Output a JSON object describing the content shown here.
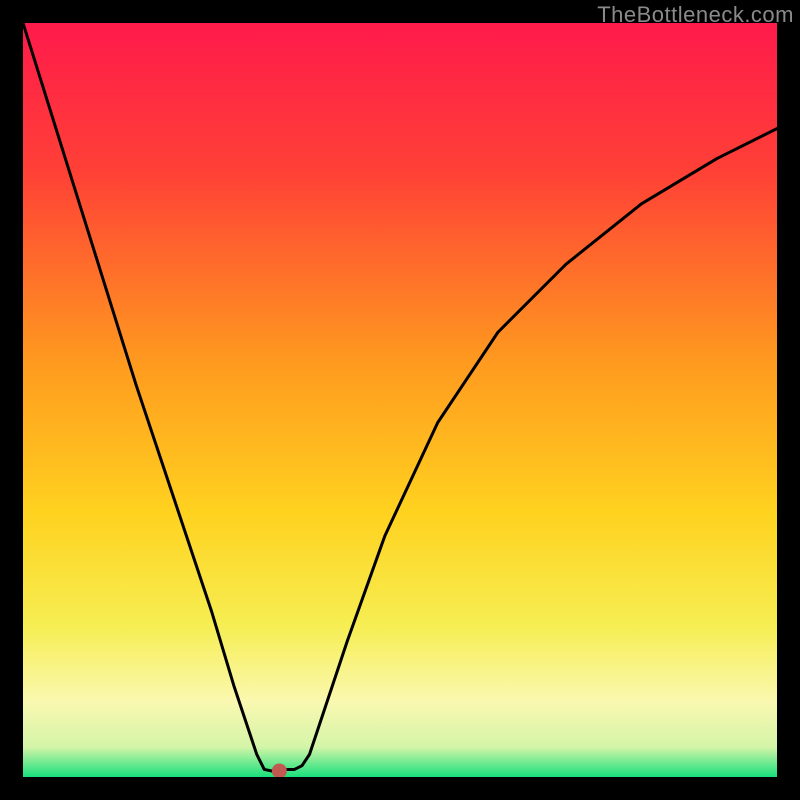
{
  "watermark": "TheBottleneck.com",
  "chart_data": {
    "type": "line",
    "title": "",
    "xlabel": "",
    "ylabel": "",
    "xlim": [
      0,
      100
    ],
    "ylim": [
      0,
      100
    ],
    "gradient_stops": [
      {
        "offset": 0,
        "color": "#ff1a4b"
      },
      {
        "offset": 20,
        "color": "#ff4136"
      },
      {
        "offset": 45,
        "color": "#ff9a1f"
      },
      {
        "offset": 65,
        "color": "#ffd21f"
      },
      {
        "offset": 80,
        "color": "#f6ee53"
      },
      {
        "offset": 90,
        "color": "#faf8b0"
      },
      {
        "offset": 96,
        "color": "#d4f5a8"
      },
      {
        "offset": 100,
        "color": "#18e07c"
      }
    ],
    "series": [
      {
        "name": "bottleneck-curve",
        "x": [
          0,
          5,
          10,
          15,
          20,
          25,
          28,
          30,
          31,
          32,
          33,
          34,
          35,
          36,
          37,
          38,
          40,
          43,
          48,
          55,
          63,
          72,
          82,
          92,
          100
        ],
        "y": [
          100,
          84,
          68,
          52,
          37,
          22,
          12,
          6,
          3,
          1,
          0.8,
          0.8,
          1,
          1,
          1.5,
          3,
          9,
          18,
          32,
          47,
          59,
          68,
          76,
          82,
          86
        ]
      }
    ],
    "marker": {
      "x": 34,
      "y": 0.8,
      "color": "#c05a50",
      "radius": 7.5
    }
  }
}
